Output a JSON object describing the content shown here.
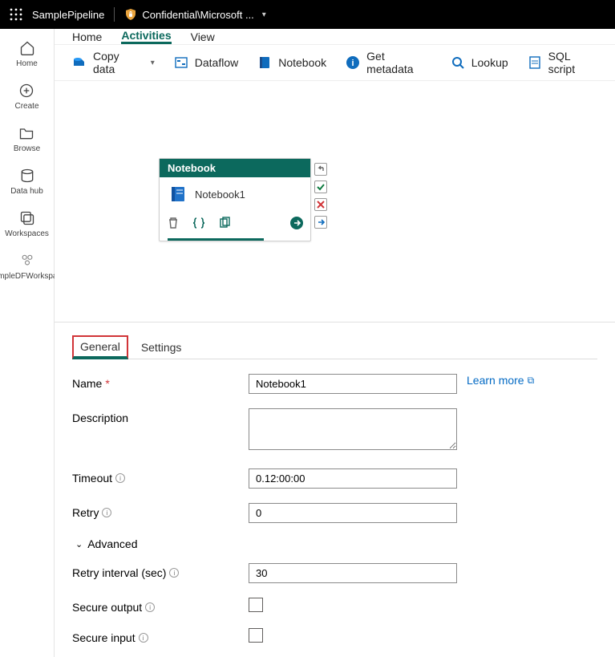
{
  "topbar": {
    "pipeline_name": "SamplePipeline",
    "sensitivity": "Confidential\\Microsoft ..."
  },
  "rail": {
    "home": "Home",
    "create": "Create",
    "browse": "Browse",
    "datahub": "Data hub",
    "workspaces": "Workspaces",
    "workspace_name": "SampleDFWorkspace"
  },
  "tabs": {
    "home": "Home",
    "activities": "Activities",
    "view": "View"
  },
  "ribbon": {
    "copy_data": "Copy data",
    "dataflow": "Dataflow",
    "notebook": "Notebook",
    "get_metadata": "Get metadata",
    "lookup": "Lookup",
    "sql_script": "SQL script"
  },
  "node": {
    "header": "Notebook",
    "label": "Notebook1"
  },
  "prop_tabs": {
    "general": "General",
    "settings": "Settings"
  },
  "form": {
    "name_label": "Name",
    "name_value": "Notebook1",
    "learn_more": "Learn more",
    "description_label": "Description",
    "description_value": "",
    "timeout_label": "Timeout",
    "timeout_value": "0.12:00:00",
    "retry_label": "Retry",
    "retry_value": "0",
    "advanced": "Advanced",
    "retry_interval_label": "Retry interval (sec)",
    "retry_interval_value": "30",
    "secure_output_label": "Secure output",
    "secure_input_label": "Secure input"
  }
}
